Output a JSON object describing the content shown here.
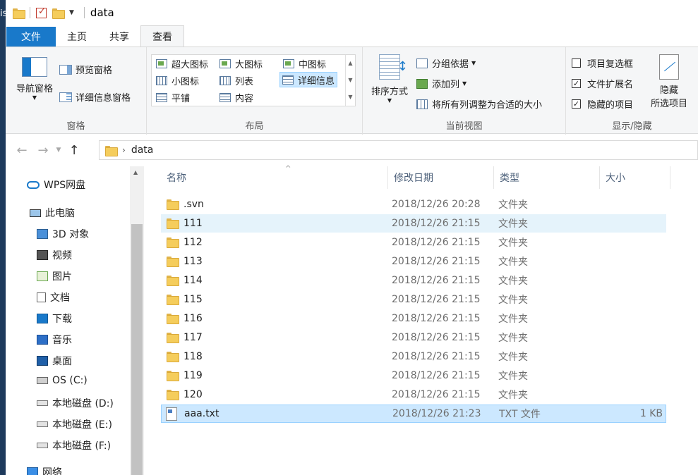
{
  "window": {
    "title": "data",
    "desktop_edge_text": "is"
  },
  "tabs": [
    {
      "label": "文件"
    },
    {
      "label": "主页"
    },
    {
      "label": "共享"
    },
    {
      "label": "查看"
    }
  ],
  "ribbon": {
    "panes": {
      "label": "窗格",
      "nav_pane": "导航窗格",
      "preview_pane": "预览窗格",
      "details_pane": "详细信息窗格"
    },
    "layout": {
      "label": "布局",
      "items": [
        "超大图标",
        "大图标",
        "中图标",
        "小图标",
        "列表",
        "详细信息",
        "平铺",
        "内容"
      ],
      "selected": "详细信息"
    },
    "current_view": {
      "label": "当前视图",
      "sort_by": "排序方式",
      "group_by": "分组依据",
      "add_columns": "添加列",
      "size_all_columns": "将所有列调整为合适的大小"
    },
    "show_hide": {
      "label": "显示/隐藏",
      "item_checkboxes": {
        "label": "项目复选框",
        "checked": false
      },
      "file_extensions": {
        "label": "文件扩展名",
        "checked": true
      },
      "hidden_items": {
        "label": "隐藏的项目",
        "checked": true
      },
      "hide_selected_line1": "隐藏",
      "hide_selected_line2": "所选项目"
    }
  },
  "address": {
    "path": "data"
  },
  "nav": {
    "items": [
      {
        "label": "WPS网盘",
        "icon": "cloud-icon"
      },
      {
        "label": "此电脑",
        "icon": "computer-icon"
      },
      {
        "label": "3D 对象",
        "icon": "3d-objects-icon"
      },
      {
        "label": "视频",
        "icon": "video-icon"
      },
      {
        "label": "图片",
        "icon": "pictures-icon"
      },
      {
        "label": "文档",
        "icon": "documents-icon"
      },
      {
        "label": "下载",
        "icon": "downloads-icon"
      },
      {
        "label": "音乐",
        "icon": "music-icon"
      },
      {
        "label": "桌面",
        "icon": "desktop-icon"
      },
      {
        "label": "OS (C:)",
        "icon": "os-drive-icon"
      },
      {
        "label": "本地磁盘 (D:)",
        "icon": "drive-icon"
      },
      {
        "label": "本地磁盘 (E:)",
        "icon": "drive-icon"
      },
      {
        "label": "本地磁盘 (F:)",
        "icon": "drive-icon"
      },
      {
        "label": "网络",
        "icon": "network-icon"
      }
    ]
  },
  "columns": {
    "name": "名称",
    "date": "修改日期",
    "type": "类型",
    "size": "大小"
  },
  "files": [
    {
      "name": ".svn",
      "date": "2018/12/26 20:28",
      "type": "文件夹",
      "size": ""
    },
    {
      "name": "111",
      "date": "2018/12/26 21:15",
      "type": "文件夹",
      "size": ""
    },
    {
      "name": "112",
      "date": "2018/12/26 21:15",
      "type": "文件夹",
      "size": ""
    },
    {
      "name": "113",
      "date": "2018/12/26 21:15",
      "type": "文件夹",
      "size": ""
    },
    {
      "name": "114",
      "date": "2018/12/26 21:15",
      "type": "文件夹",
      "size": ""
    },
    {
      "name": "115",
      "date": "2018/12/26 21:15",
      "type": "文件夹",
      "size": ""
    },
    {
      "name": "116",
      "date": "2018/12/26 21:15",
      "type": "文件夹",
      "size": ""
    },
    {
      "name": "117",
      "date": "2018/12/26 21:15",
      "type": "文件夹",
      "size": ""
    },
    {
      "name": "118",
      "date": "2018/12/26 21:15",
      "type": "文件夹",
      "size": ""
    },
    {
      "name": "119",
      "date": "2018/12/26 21:15",
      "type": "文件夹",
      "size": ""
    },
    {
      "name": "120",
      "date": "2018/12/26 21:15",
      "type": "文件夹",
      "size": ""
    },
    {
      "name": "aaa.txt",
      "date": "2018/12/26 21:23",
      "type": "TXT 文件",
      "size": "1 KB"
    }
  ],
  "colors": {
    "accent": "#1979ca",
    "selection": "#cce8ff",
    "hover": "#e5f3fb",
    "folder": "#f5cd5c"
  }
}
